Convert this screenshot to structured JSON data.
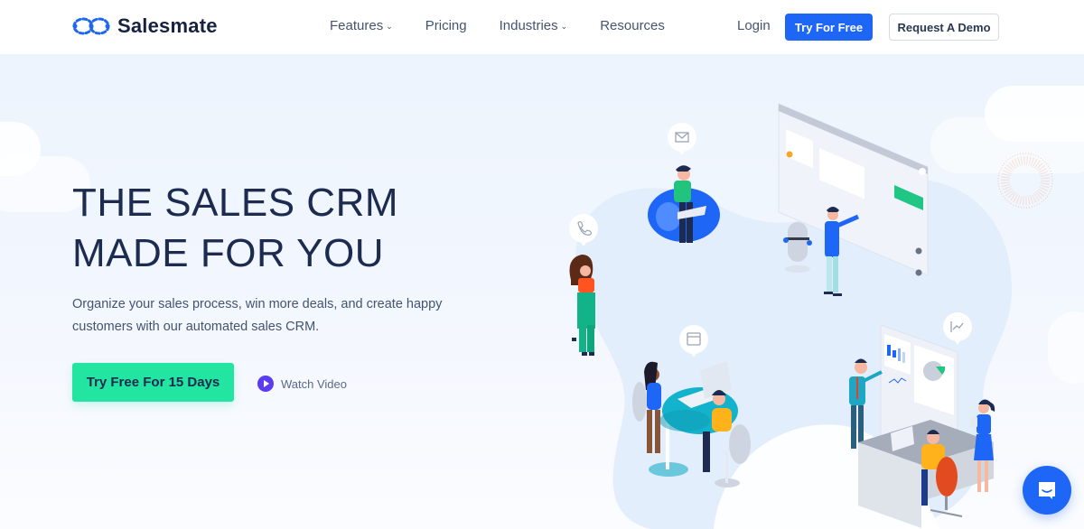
{
  "header": {
    "brand": "Salesmate",
    "nav": [
      {
        "label": "Features",
        "has_dropdown": true
      },
      {
        "label": "Pricing",
        "has_dropdown": false
      },
      {
        "label": "Industries",
        "has_dropdown": true
      },
      {
        "label": "Resources",
        "has_dropdown": false
      }
    ],
    "login_label": "Login",
    "try_label": "Try For Free",
    "demo_label": "Request A Demo",
    "chevron_glyph": "⌄"
  },
  "hero": {
    "headline_line1": "THE SALES CRM",
    "headline_line2": "MADE FOR YOU",
    "subtext": "Organize your sales process, win more deals, and create happy customers with our automated sales CRM.",
    "cta_label": "Try Free For 15 Days",
    "watch_label": "Watch Video"
  },
  "illustration": {
    "bubbles": [
      "mail-icon",
      "phone-icon",
      "calendar-icon",
      "chart-icon"
    ]
  },
  "colors": {
    "primary_blue": "#1e66f5",
    "cta_green": "#22e5a1",
    "navy_text": "#1c2b4f",
    "play_purple": "#5b3cf0"
  }
}
